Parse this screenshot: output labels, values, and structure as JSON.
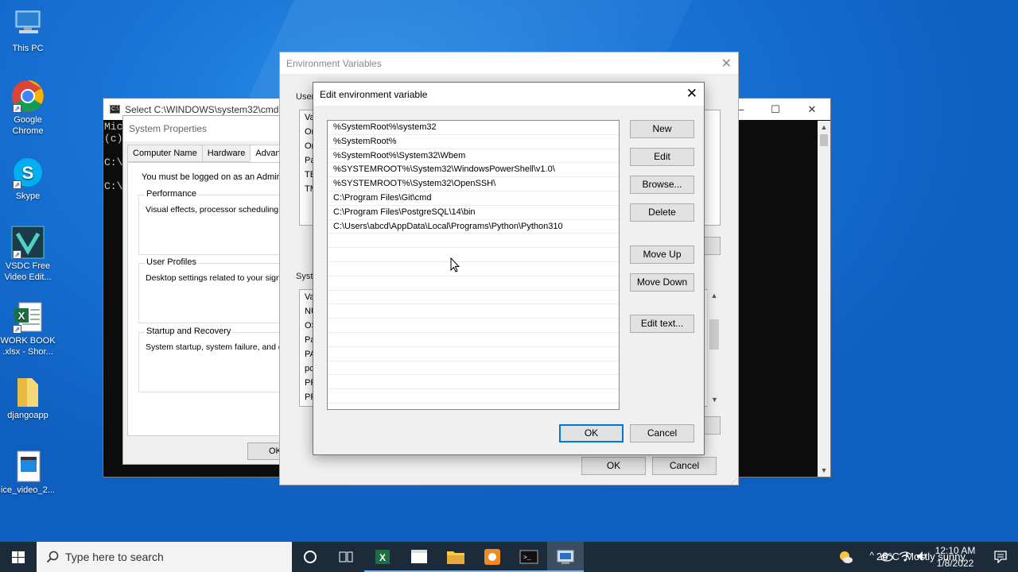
{
  "desktop": {
    "icons": [
      {
        "label": "This PC",
        "icon": "pc-icon"
      },
      {
        "label": "Google Chrome",
        "icon": "chrome-icon"
      },
      {
        "label": "Skype",
        "icon": "skype-icon"
      },
      {
        "label": "VSDC Free Video Edit...",
        "icon": "vsdc-icon"
      },
      {
        "label": "WORK BOOK .xlsx - Shor...",
        "icon": "excel-file-icon"
      },
      {
        "label": "djangoapp",
        "icon": "folder-icon"
      },
      {
        "label": "ice_video_2...",
        "icon": "video-file-icon"
      }
    ]
  },
  "cmd": {
    "title": "Select C:\\WINDOWS\\system32\\cmd.exe",
    "lines": [
      "Mic",
      "(c)",
      "",
      "C:\\",
      "",
      "C:\\"
    ]
  },
  "system_properties": {
    "title": "System Properties",
    "tabs": [
      "Computer Name",
      "Hardware",
      "Advanced"
    ],
    "warning": "You must be logged on as an Administrator",
    "groups": [
      {
        "title": "Performance",
        "desc": "Visual effects, processor scheduling, m"
      },
      {
        "title": "User Profiles",
        "desc": "Desktop settings related to your sign-in"
      },
      {
        "title": "Startup and Recovery",
        "desc": "System startup, system failure, and deb"
      }
    ],
    "ok": "OK"
  },
  "env_vars": {
    "title": "Environment Variables",
    "user_label": "User",
    "user_rows": [
      "Va",
      "Or",
      "Or",
      "Pa",
      "TE",
      "TM"
    ],
    "system_label": "Syste",
    "system_rows": [
      "Va",
      "NU",
      "OS",
      "Pa",
      "PA",
      "pc",
      "PR",
      "PR"
    ],
    "ok": "OK",
    "cancel": "Cancel"
  },
  "edit_dialog": {
    "title": "Edit environment variable",
    "paths": [
      "%SystemRoot%\\system32",
      "%SystemRoot%",
      "%SystemRoot%\\System32\\Wbem",
      "%SYSTEMROOT%\\System32\\WindowsPowerShell\\v1.0\\",
      "%SYSTEMROOT%\\System32\\OpenSSH\\",
      "C:\\Program Files\\Git\\cmd",
      "C:\\Program Files\\PostgreSQL\\14\\bin",
      "C:\\Users\\abcd\\AppData\\Local\\Programs\\Python\\Python310"
    ],
    "buttons": {
      "new": "New",
      "edit": "Edit",
      "browse": "Browse...",
      "delete": "Delete",
      "move_up": "Move Up",
      "move_down": "Move Down",
      "edit_text": "Edit text...",
      "ok": "OK",
      "cancel": "Cancel"
    }
  },
  "taskbar": {
    "search_placeholder": "Type here to search",
    "weather": "26°C  Mostly sunny",
    "time": "12:10 AM",
    "date": "1/8/2022"
  }
}
